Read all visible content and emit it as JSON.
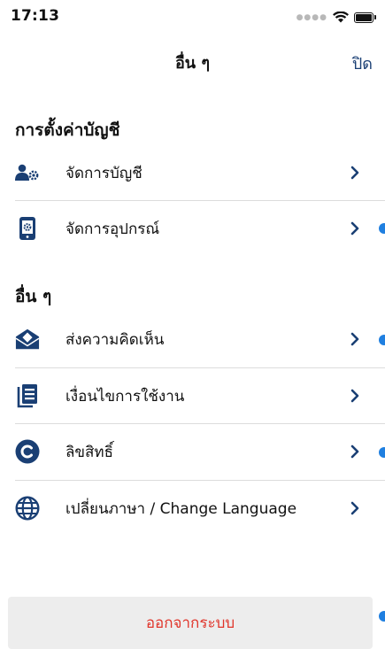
{
  "status_bar": {
    "time": "17:13"
  },
  "nav": {
    "title": "อื่น ๆ",
    "close": "ปิด"
  },
  "sections": [
    {
      "header": "การตั้งค่าบัญชี",
      "items": [
        {
          "label": "จัดการบัญชี",
          "icon": "account-settings-icon"
        },
        {
          "label": "จัดการอุปกรณ์",
          "icon": "device-settings-icon"
        }
      ]
    },
    {
      "header": "อื่น ๆ",
      "items": [
        {
          "label": "ส่งความคิดเห็น",
          "icon": "feedback-mail-icon"
        },
        {
          "label": "เงื่อนไขการใช้งาน",
          "icon": "documents-icon"
        },
        {
          "label": "ลิขสิทธิ์",
          "icon": "copyright-icon"
        },
        {
          "label": "เปลี่ยนภาษา / Change Language",
          "icon": "globe-icon"
        }
      ]
    }
  ],
  "logout": "ออกจากระบบ",
  "colors": {
    "brand": "#1a3f74",
    "logout_text": "#e0352b",
    "dot": "#1f7fe0"
  }
}
